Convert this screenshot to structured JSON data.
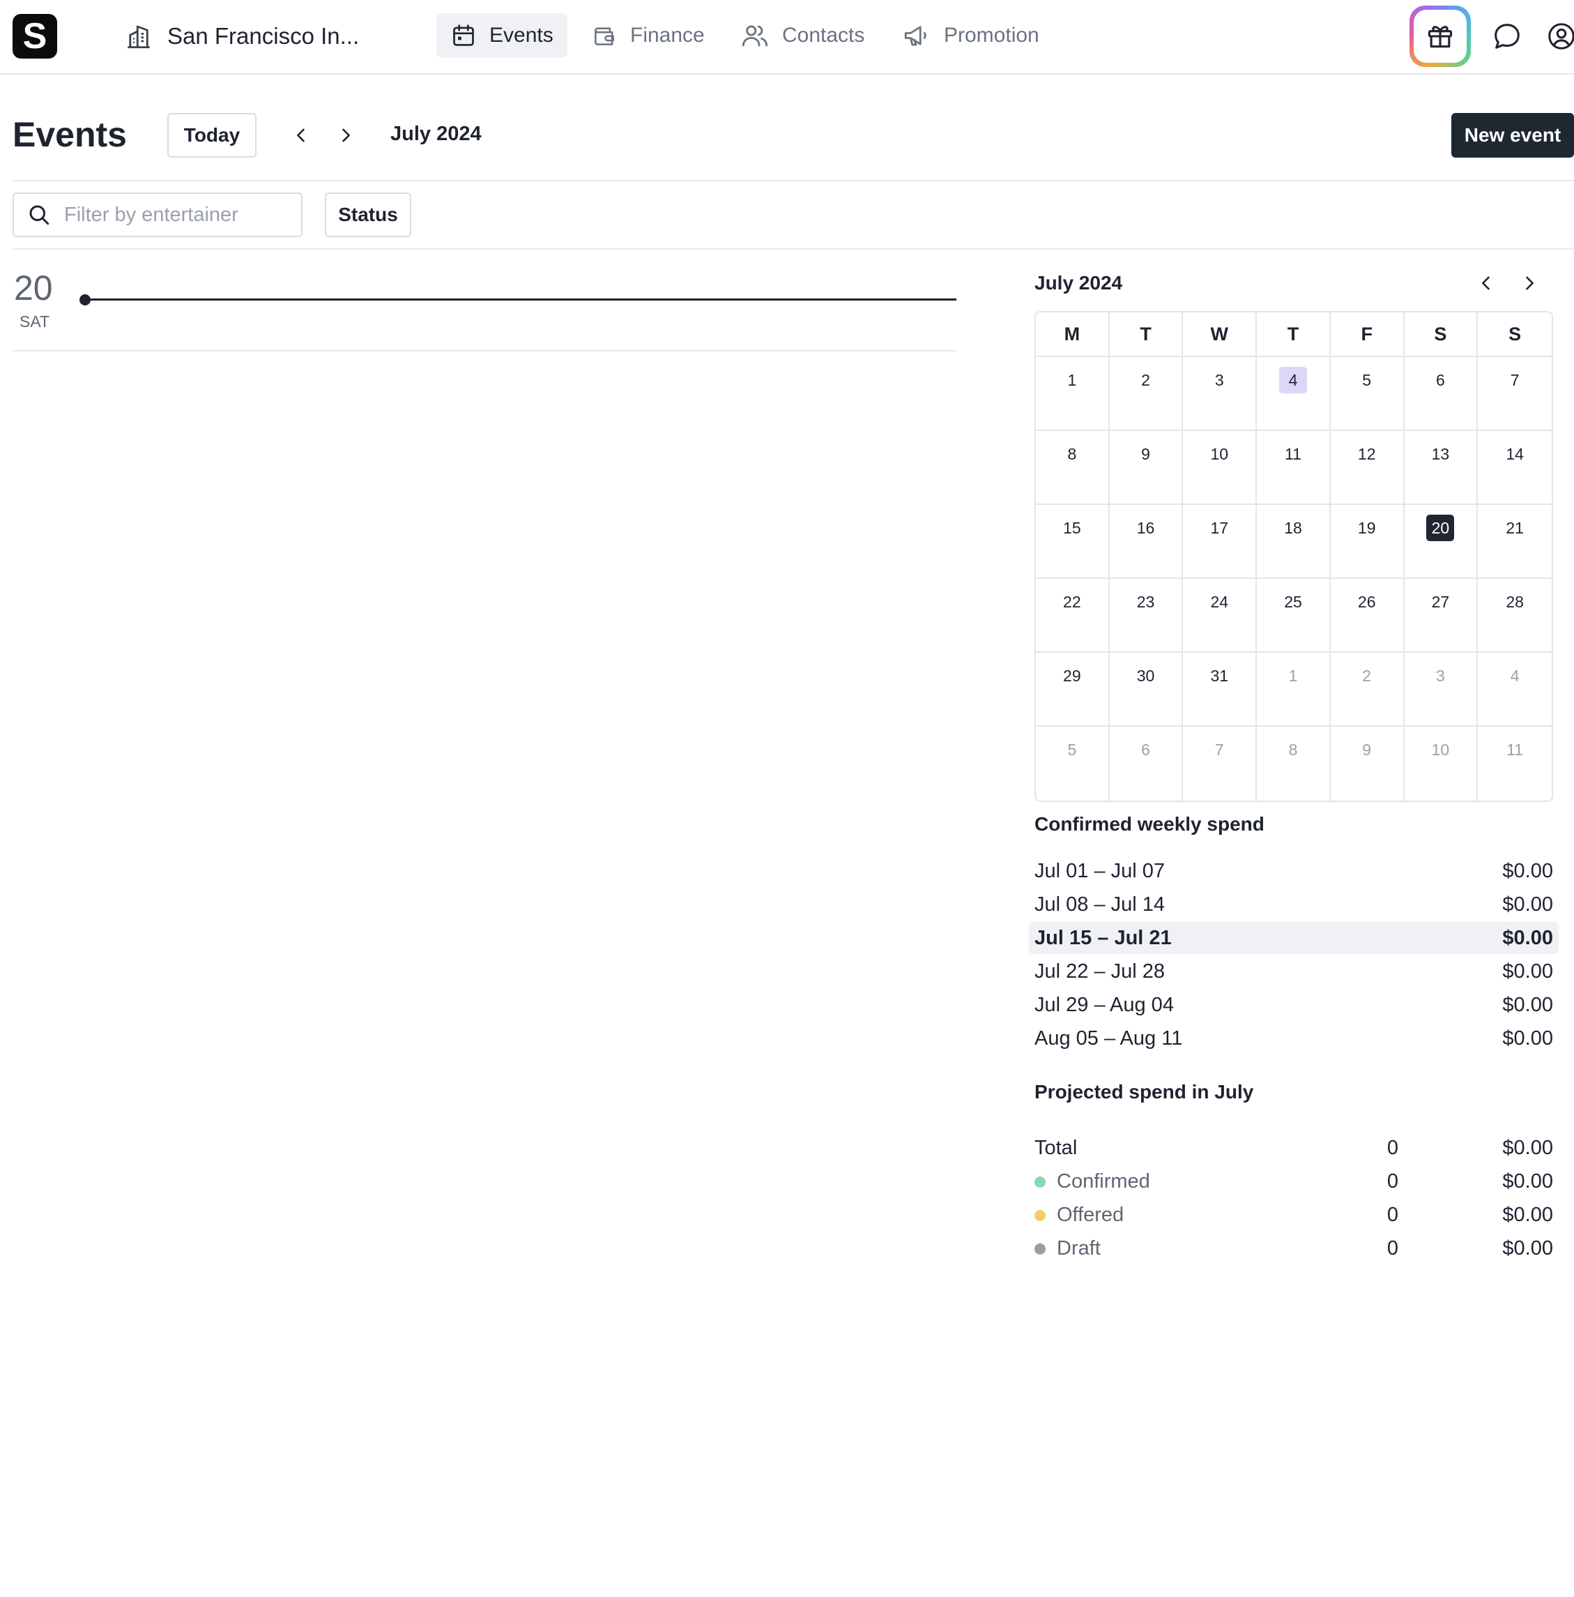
{
  "app": {
    "logo_letter": "S",
    "venue_name": "San Francisco In..."
  },
  "nav": {
    "tabs": [
      {
        "label": "Events",
        "icon": "calendar-icon",
        "active": true
      },
      {
        "label": "Finance",
        "icon": "wallet-icon",
        "active": false
      },
      {
        "label": "Contacts",
        "icon": "users-icon",
        "active": false
      },
      {
        "label": "Promotion",
        "icon": "megaphone-icon",
        "active": false
      }
    ],
    "right_icons": [
      "gift-icon",
      "chat-bubble-icon",
      "user-circle-icon"
    ]
  },
  "header": {
    "title": "Events",
    "today_label": "Today",
    "period_label": "July 2024",
    "new_event_label": "New event"
  },
  "filters": {
    "search_placeholder": "Filter by entertainer",
    "status_label": "Status"
  },
  "day_view": {
    "day_number": "20",
    "day_of_week": "SAT"
  },
  "mini_calendar": {
    "title": "July 2024",
    "weekdays": [
      "M",
      "T",
      "W",
      "T",
      "F",
      "S",
      "S"
    ],
    "days": [
      {
        "d": "1",
        "m": false
      },
      {
        "d": "2",
        "m": false
      },
      {
        "d": "3",
        "m": false
      },
      {
        "d": "4",
        "m": false,
        "hl": true
      },
      {
        "d": "5",
        "m": false
      },
      {
        "d": "6",
        "m": false
      },
      {
        "d": "7",
        "m": false
      },
      {
        "d": "8",
        "m": false
      },
      {
        "d": "9",
        "m": false
      },
      {
        "d": "10",
        "m": false
      },
      {
        "d": "11",
        "m": false
      },
      {
        "d": "12",
        "m": false
      },
      {
        "d": "13",
        "m": false
      },
      {
        "d": "14",
        "m": false
      },
      {
        "d": "15",
        "m": false
      },
      {
        "d": "16",
        "m": false
      },
      {
        "d": "17",
        "m": false
      },
      {
        "d": "18",
        "m": false
      },
      {
        "d": "19",
        "m": false
      },
      {
        "d": "20",
        "m": false,
        "sel": true
      },
      {
        "d": "21",
        "m": false
      },
      {
        "d": "22",
        "m": false
      },
      {
        "d": "23",
        "m": false
      },
      {
        "d": "24",
        "m": false
      },
      {
        "d": "25",
        "m": false
      },
      {
        "d": "26",
        "m": false
      },
      {
        "d": "27",
        "m": false
      },
      {
        "d": "28",
        "m": false
      },
      {
        "d": "29",
        "m": false
      },
      {
        "d": "30",
        "m": false
      },
      {
        "d": "31",
        "m": false
      },
      {
        "d": "1",
        "m": true
      },
      {
        "d": "2",
        "m": true
      },
      {
        "d": "3",
        "m": true
      },
      {
        "d": "4",
        "m": true
      },
      {
        "d": "5",
        "m": true
      },
      {
        "d": "6",
        "m": true
      },
      {
        "d": "7",
        "m": true
      },
      {
        "d": "8",
        "m": true
      },
      {
        "d": "9",
        "m": true
      },
      {
        "d": "10",
        "m": true
      },
      {
        "d": "11",
        "m": true
      }
    ]
  },
  "weekly_spend": {
    "title": "Confirmed weekly spend",
    "rows": [
      {
        "range": "Jul 01 – Jul 07",
        "amount": "$0.00"
      },
      {
        "range": "Jul 08 – Jul 14",
        "amount": "$0.00"
      },
      {
        "range": "Jul 15 – Jul 21",
        "amount": "$0.00",
        "current": true
      },
      {
        "range": "Jul 22 – Jul 28",
        "amount": "$0.00"
      },
      {
        "range": "Jul 29 – Aug 04",
        "amount": "$0.00"
      },
      {
        "range": "Aug 05 – Aug 11",
        "amount": "$0.00"
      }
    ]
  },
  "projected": {
    "title": "Projected spend in July",
    "rows": [
      {
        "label": "Total",
        "count": "0",
        "amount": "$0.00"
      },
      {
        "label": "Confirmed",
        "count": "0",
        "amount": "$0.00",
        "color": "#86dcae"
      },
      {
        "label": "Offered",
        "count": "0",
        "amount": "$0.00",
        "color": "#f3cf63"
      },
      {
        "label": "Draft",
        "count": "0",
        "amount": "$0.00",
        "color": "#9a9ca6"
      }
    ]
  }
}
